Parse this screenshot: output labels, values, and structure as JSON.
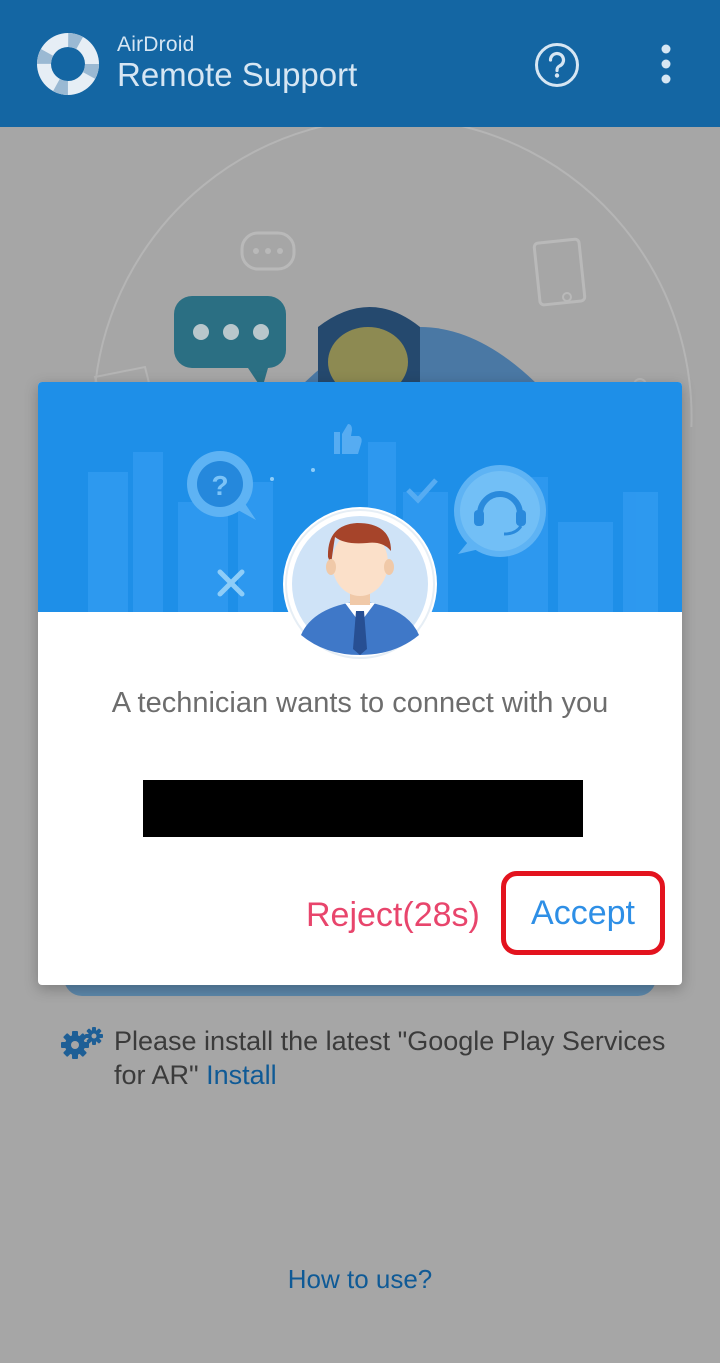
{
  "app_bar": {
    "title_small": "AirDroid",
    "title_large": "Remote Support",
    "help_icon": "question-circle-icon",
    "menu_icon": "more-vert-icon",
    "color": "#1466a3"
  },
  "main": {
    "notice_text": "Please install the latest \"Google Play Services for AR\"",
    "install_link": "Install",
    "how_to_use": "How to use?"
  },
  "dialog": {
    "message": "A technician wants to connect with you",
    "reject_label": "Reject(28s)",
    "accept_label": "Accept",
    "banner_color": "#1e8fe8",
    "reject_color": "#e8456c",
    "accept_color": "#2e8fe6",
    "highlight_color": "#e3131e"
  }
}
